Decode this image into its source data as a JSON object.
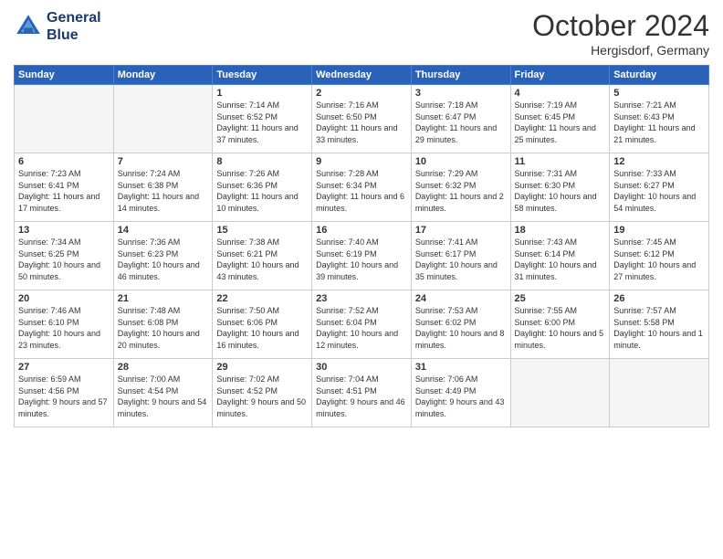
{
  "header": {
    "logo_line1": "General",
    "logo_line2": "Blue",
    "month": "October 2024",
    "location": "Hergisdorf, Germany"
  },
  "weekdays": [
    "Sunday",
    "Monday",
    "Tuesday",
    "Wednesday",
    "Thursday",
    "Friday",
    "Saturday"
  ],
  "weeks": [
    [
      {
        "day": "",
        "sunrise": "",
        "sunset": "",
        "daylight": "",
        "empty": true
      },
      {
        "day": "",
        "sunrise": "",
        "sunset": "",
        "daylight": "",
        "empty": true
      },
      {
        "day": "1",
        "sunrise": "Sunrise: 7:14 AM",
        "sunset": "Sunset: 6:52 PM",
        "daylight": "Daylight: 11 hours and 37 minutes."
      },
      {
        "day": "2",
        "sunrise": "Sunrise: 7:16 AM",
        "sunset": "Sunset: 6:50 PM",
        "daylight": "Daylight: 11 hours and 33 minutes."
      },
      {
        "day": "3",
        "sunrise": "Sunrise: 7:18 AM",
        "sunset": "Sunset: 6:47 PM",
        "daylight": "Daylight: 11 hours and 29 minutes."
      },
      {
        "day": "4",
        "sunrise": "Sunrise: 7:19 AM",
        "sunset": "Sunset: 6:45 PM",
        "daylight": "Daylight: 11 hours and 25 minutes."
      },
      {
        "day": "5",
        "sunrise": "Sunrise: 7:21 AM",
        "sunset": "Sunset: 6:43 PM",
        "daylight": "Daylight: 11 hours and 21 minutes."
      }
    ],
    [
      {
        "day": "6",
        "sunrise": "Sunrise: 7:23 AM",
        "sunset": "Sunset: 6:41 PM",
        "daylight": "Daylight: 11 hours and 17 minutes."
      },
      {
        "day": "7",
        "sunrise": "Sunrise: 7:24 AM",
        "sunset": "Sunset: 6:38 PM",
        "daylight": "Daylight: 11 hours and 14 minutes."
      },
      {
        "day": "8",
        "sunrise": "Sunrise: 7:26 AM",
        "sunset": "Sunset: 6:36 PM",
        "daylight": "Daylight: 11 hours and 10 minutes."
      },
      {
        "day": "9",
        "sunrise": "Sunrise: 7:28 AM",
        "sunset": "Sunset: 6:34 PM",
        "daylight": "Daylight: 11 hours and 6 minutes."
      },
      {
        "day": "10",
        "sunrise": "Sunrise: 7:29 AM",
        "sunset": "Sunset: 6:32 PM",
        "daylight": "Daylight: 11 hours and 2 minutes."
      },
      {
        "day": "11",
        "sunrise": "Sunrise: 7:31 AM",
        "sunset": "Sunset: 6:30 PM",
        "daylight": "Daylight: 10 hours and 58 minutes."
      },
      {
        "day": "12",
        "sunrise": "Sunrise: 7:33 AM",
        "sunset": "Sunset: 6:27 PM",
        "daylight": "Daylight: 10 hours and 54 minutes."
      }
    ],
    [
      {
        "day": "13",
        "sunrise": "Sunrise: 7:34 AM",
        "sunset": "Sunset: 6:25 PM",
        "daylight": "Daylight: 10 hours and 50 minutes."
      },
      {
        "day": "14",
        "sunrise": "Sunrise: 7:36 AM",
        "sunset": "Sunset: 6:23 PM",
        "daylight": "Daylight: 10 hours and 46 minutes."
      },
      {
        "day": "15",
        "sunrise": "Sunrise: 7:38 AM",
        "sunset": "Sunset: 6:21 PM",
        "daylight": "Daylight: 10 hours and 43 minutes."
      },
      {
        "day": "16",
        "sunrise": "Sunrise: 7:40 AM",
        "sunset": "Sunset: 6:19 PM",
        "daylight": "Daylight: 10 hours and 39 minutes."
      },
      {
        "day": "17",
        "sunrise": "Sunrise: 7:41 AM",
        "sunset": "Sunset: 6:17 PM",
        "daylight": "Daylight: 10 hours and 35 minutes."
      },
      {
        "day": "18",
        "sunrise": "Sunrise: 7:43 AM",
        "sunset": "Sunset: 6:14 PM",
        "daylight": "Daylight: 10 hours and 31 minutes."
      },
      {
        "day": "19",
        "sunrise": "Sunrise: 7:45 AM",
        "sunset": "Sunset: 6:12 PM",
        "daylight": "Daylight: 10 hours and 27 minutes."
      }
    ],
    [
      {
        "day": "20",
        "sunrise": "Sunrise: 7:46 AM",
        "sunset": "Sunset: 6:10 PM",
        "daylight": "Daylight: 10 hours and 23 minutes."
      },
      {
        "day": "21",
        "sunrise": "Sunrise: 7:48 AM",
        "sunset": "Sunset: 6:08 PM",
        "daylight": "Daylight: 10 hours and 20 minutes."
      },
      {
        "day": "22",
        "sunrise": "Sunrise: 7:50 AM",
        "sunset": "Sunset: 6:06 PM",
        "daylight": "Daylight: 10 hours and 16 minutes."
      },
      {
        "day": "23",
        "sunrise": "Sunrise: 7:52 AM",
        "sunset": "Sunset: 6:04 PM",
        "daylight": "Daylight: 10 hours and 12 minutes."
      },
      {
        "day": "24",
        "sunrise": "Sunrise: 7:53 AM",
        "sunset": "Sunset: 6:02 PM",
        "daylight": "Daylight: 10 hours and 8 minutes."
      },
      {
        "day": "25",
        "sunrise": "Sunrise: 7:55 AM",
        "sunset": "Sunset: 6:00 PM",
        "daylight": "Daylight: 10 hours and 5 minutes."
      },
      {
        "day": "26",
        "sunrise": "Sunrise: 7:57 AM",
        "sunset": "Sunset: 5:58 PM",
        "daylight": "Daylight: 10 hours and 1 minute."
      }
    ],
    [
      {
        "day": "27",
        "sunrise": "Sunrise: 6:59 AM",
        "sunset": "Sunset: 4:56 PM",
        "daylight": "Daylight: 9 hours and 57 minutes."
      },
      {
        "day": "28",
        "sunrise": "Sunrise: 7:00 AM",
        "sunset": "Sunset: 4:54 PM",
        "daylight": "Daylight: 9 hours and 54 minutes."
      },
      {
        "day": "29",
        "sunrise": "Sunrise: 7:02 AM",
        "sunset": "Sunset: 4:52 PM",
        "daylight": "Daylight: 9 hours and 50 minutes."
      },
      {
        "day": "30",
        "sunrise": "Sunrise: 7:04 AM",
        "sunset": "Sunset: 4:51 PM",
        "daylight": "Daylight: 9 hours and 46 minutes."
      },
      {
        "day": "31",
        "sunrise": "Sunrise: 7:06 AM",
        "sunset": "Sunset: 4:49 PM",
        "daylight": "Daylight: 9 hours and 43 minutes."
      },
      {
        "day": "",
        "sunrise": "",
        "sunset": "",
        "daylight": "",
        "empty": true
      },
      {
        "day": "",
        "sunrise": "",
        "sunset": "",
        "daylight": "",
        "empty": true
      }
    ]
  ]
}
